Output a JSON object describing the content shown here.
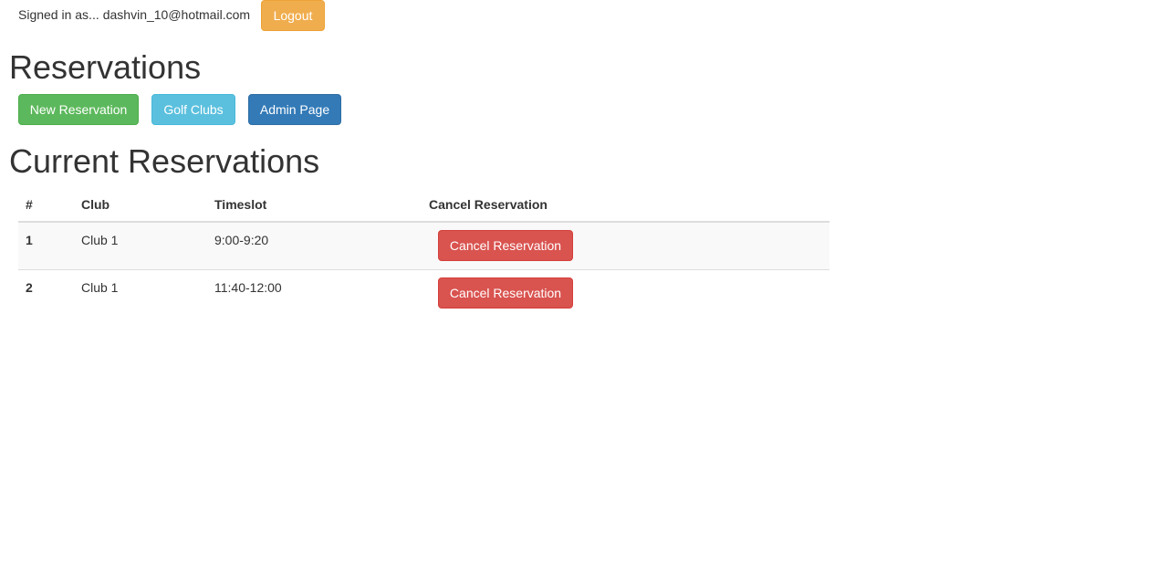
{
  "header": {
    "signed_in_prefix": "Signed in as...",
    "user_email": "dashvin_10@hotmail.com",
    "logout_label": "Logout"
  },
  "page_title": "Reservations",
  "nav": {
    "new_reservation_label": "New Reservation",
    "golf_clubs_label": "Golf Clubs",
    "admin_page_label": "Admin Page"
  },
  "current_title": "Current Reservations",
  "table": {
    "columns": [
      "#",
      "Club",
      "Timeslot",
      "Cancel Reservation"
    ],
    "rows": [
      {
        "num": "1",
        "club": "Club 1",
        "timeslot": "9:00-9:20",
        "action_label": "Cancel Reservation"
      },
      {
        "num": "2",
        "club": "Club 1",
        "timeslot": "11:40-12:00",
        "action_label": "Cancel Reservation"
      }
    ]
  },
  "colors": {
    "warning": "#f0ad4e",
    "success": "#5cb85c",
    "info": "#5bc0de",
    "primary": "#337ab7",
    "danger": "#d9534f"
  }
}
